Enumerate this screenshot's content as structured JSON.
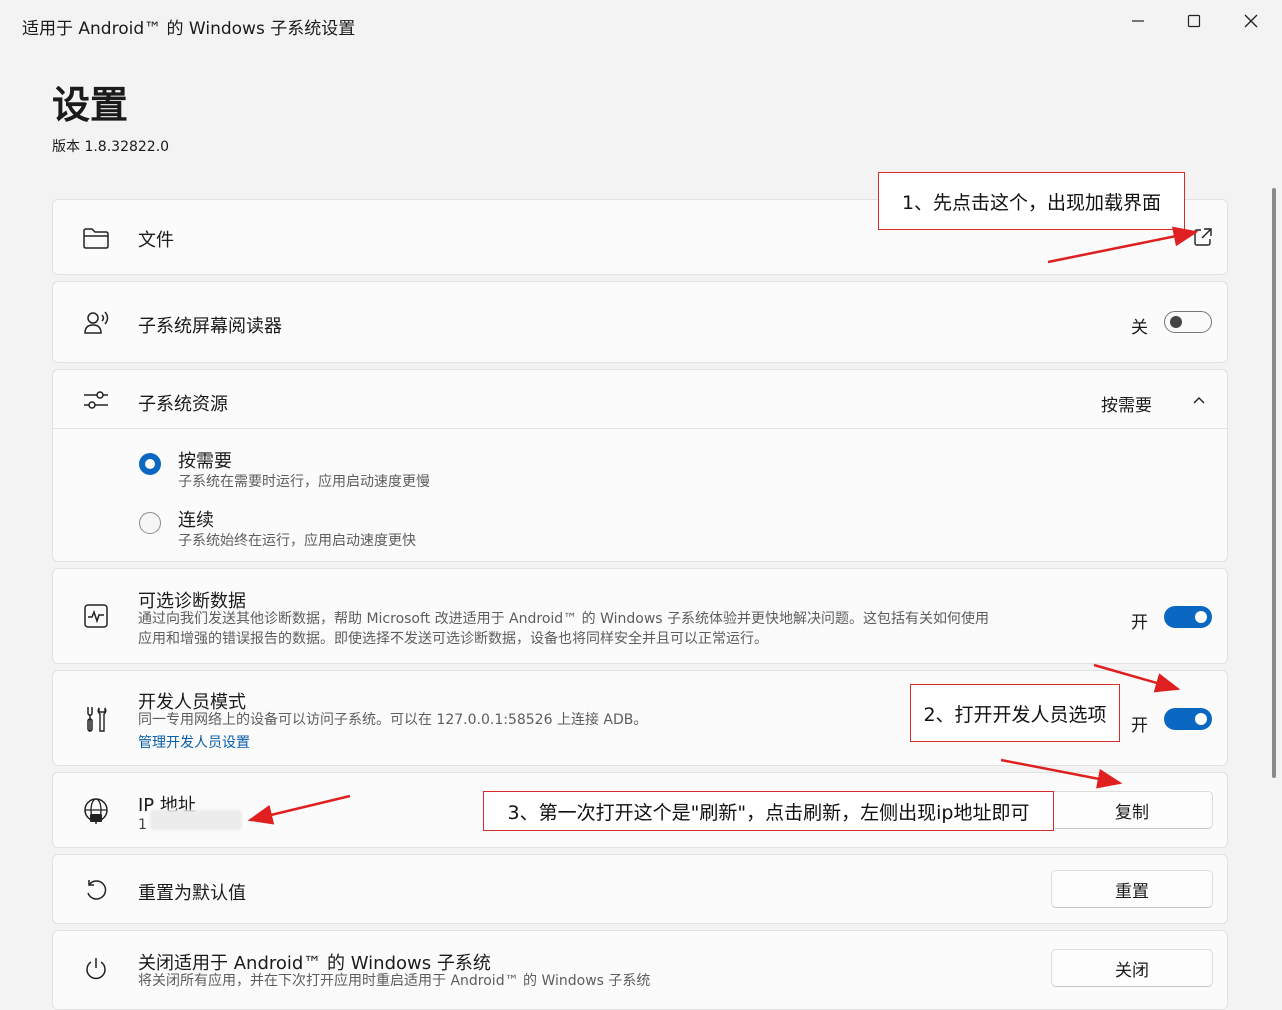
{
  "window": {
    "title": "适用于 Android™ 的 Windows 子系统设置",
    "minimize_glyph": "—",
    "maximize_glyph": "☐",
    "close_glyph": "✕"
  },
  "page": {
    "title": "设置",
    "version": "版本 1.8.32822.0"
  },
  "files": {
    "label": "文件",
    "icon": "folder-icon",
    "action_icon": "open-external-icon"
  },
  "screen_reader": {
    "label": "子系统屏幕阅读器",
    "state": "关",
    "toggle_on": false,
    "icon": "screen-reader-icon"
  },
  "resources": {
    "label": "子系统资源",
    "value": "按需要",
    "icon": "sliders-icon",
    "options": [
      {
        "label": "按需要",
        "description": "子系统在需要时运行，应用启动速度更慢",
        "selected": true
      },
      {
        "label": "连续",
        "description": "子系统始终在运行，应用启动速度更快",
        "selected": false
      }
    ]
  },
  "diagnostics": {
    "label": "可选诊断数据",
    "line1": "通过向我们发送其他诊断数据，帮助 Microsoft 改进适用于 Android™ 的 Windows 子系统体验并更快地解决问题。这包括有关如何使用",
    "line2": "应用和增强的错误报告的数据。即使选择不发送可选诊断数据，设备也将同样安全并且可以正常运行。",
    "state": "开",
    "toggle_on": true,
    "icon": "pulse-icon"
  },
  "developer": {
    "label": "开发人员模式",
    "description": "同一专用网络上的设备可以访问子系统。可以在 127.0.0.1:58526 上连接 ADB。",
    "link": "管理开发人员设置",
    "state": "开",
    "toggle_on": true,
    "icon": "tools-icon"
  },
  "ip": {
    "label": "IP 地址",
    "value": "1",
    "button": "复制",
    "icon": "globe-icon"
  },
  "reset": {
    "label": "重置为默认值",
    "button": "重置",
    "icon": "reset-icon"
  },
  "shutdown": {
    "label": "关闭适用于 Android™ 的 Windows 子系统",
    "description": "将关闭所有应用，并在下次打开应用时重启适用于 Android™ 的 Windows 子系统",
    "button": "关闭",
    "icon": "power-icon"
  },
  "annotations": {
    "step1": "1、先点击这个，出现加载界面",
    "step2": "2、打开开发人员选项",
    "step3": "3、第一次打开这个是\"刷新\"，点击刷新，左侧出现ip地址即可"
  },
  "colors": {
    "accent": "#0a67c2",
    "annotation_red": "#d42b2b"
  }
}
